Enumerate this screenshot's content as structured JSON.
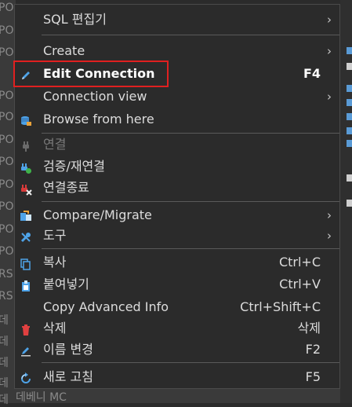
{
  "background": {
    "left_fragments": [
      "PO",
      "PO",
      "PO",
      "PO",
      "PO",
      "PO",
      "PO",
      "PO",
      "PO",
      "PO",
      "PO",
      "RS",
      "RS",
      "데",
      "데",
      "데",
      "데",
      "데"
    ],
    "bottom_text": "데베니 MC"
  },
  "menu": {
    "items": [
      {
        "label": "SQL 편집기",
        "shortcut": "",
        "submenu": true,
        "icon": ""
      },
      {
        "label": "Create",
        "shortcut": "",
        "submenu": true,
        "icon": ""
      },
      {
        "label": "Edit Connection",
        "shortcut": "F4",
        "submenu": false,
        "icon": "pencil-icon"
      },
      {
        "label": "Connection view",
        "shortcut": "",
        "submenu": true,
        "icon": ""
      },
      {
        "label": "Browse from here",
        "shortcut": "",
        "submenu": false,
        "icon": "database-browse-icon"
      },
      {
        "label": "연결",
        "shortcut": "",
        "submenu": false,
        "icon": "plug-icon"
      },
      {
        "label": "검증/재연결",
        "shortcut": "",
        "submenu": false,
        "icon": "reconnect-icon"
      },
      {
        "label": "연결종료",
        "shortcut": "",
        "submenu": false,
        "icon": "disconnect-icon"
      },
      {
        "label": "Compare/Migrate",
        "shortcut": "",
        "submenu": true,
        "icon": "compare-icon"
      },
      {
        "label": "도구",
        "shortcut": "",
        "submenu": true,
        "icon": "tools-icon"
      },
      {
        "label": "복사",
        "shortcut": "Ctrl+C",
        "submenu": false,
        "icon": "copy-icon"
      },
      {
        "label": "붙여넣기",
        "shortcut": "Ctrl+V",
        "submenu": false,
        "icon": "paste-icon"
      },
      {
        "label": "Copy Advanced Info",
        "shortcut": "Ctrl+Shift+C",
        "submenu": false,
        "icon": ""
      },
      {
        "label": "삭제",
        "shortcut": "삭제",
        "submenu": false,
        "icon": "trash-icon"
      },
      {
        "label": "이름 변경",
        "shortcut": "F2",
        "submenu": false,
        "icon": "rename-icon"
      },
      {
        "label": "새로 고침",
        "shortcut": "F5",
        "submenu": false,
        "icon": "refresh-icon"
      }
    ],
    "submenu_glyph": "›"
  }
}
